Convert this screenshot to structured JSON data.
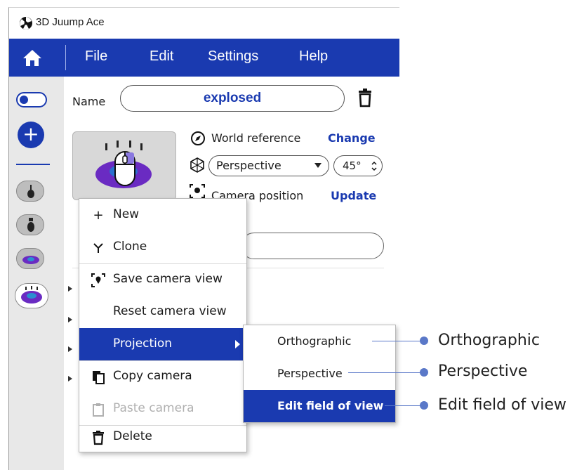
{
  "app": {
    "title": "3D Juump Ace"
  },
  "menubar": {
    "items": [
      "File",
      "Edit",
      "Settings",
      "Help"
    ]
  },
  "panel": {
    "name_label": "Name",
    "name_value": "explosed",
    "world_reference_label": "World reference",
    "change_label": "Change",
    "projection_value": "Perspective",
    "fov_value": "45°",
    "camera_position_label": "Camera position",
    "update_label": "Update"
  },
  "context_menu": {
    "items": [
      {
        "label": "New",
        "icon": "plus-icon"
      },
      {
        "label": "Clone",
        "icon": "clone-icon"
      },
      {
        "label": "Save camera view",
        "icon": "save-camera-icon"
      },
      {
        "label": "Reset camera view",
        "icon": ""
      },
      {
        "label": "Projection",
        "icon": "",
        "state": "active"
      },
      {
        "label": "Copy camera",
        "icon": "copy-icon"
      },
      {
        "label": "Paste camera",
        "icon": "paste-icon",
        "state": "disabled"
      },
      {
        "label": "Delete",
        "icon": "trash-icon"
      }
    ]
  },
  "submenu": {
    "items": [
      {
        "label": "Orthographic"
      },
      {
        "label": "Perspective"
      },
      {
        "label": "Edit field of view",
        "state": "active"
      }
    ]
  },
  "callouts": [
    "Orthographic",
    "Perspective",
    "Edit field of view"
  ],
  "colors": {
    "accent": "#1a3ab0",
    "callout": "#5a78c8",
    "disabled": "#b0b0b0"
  }
}
